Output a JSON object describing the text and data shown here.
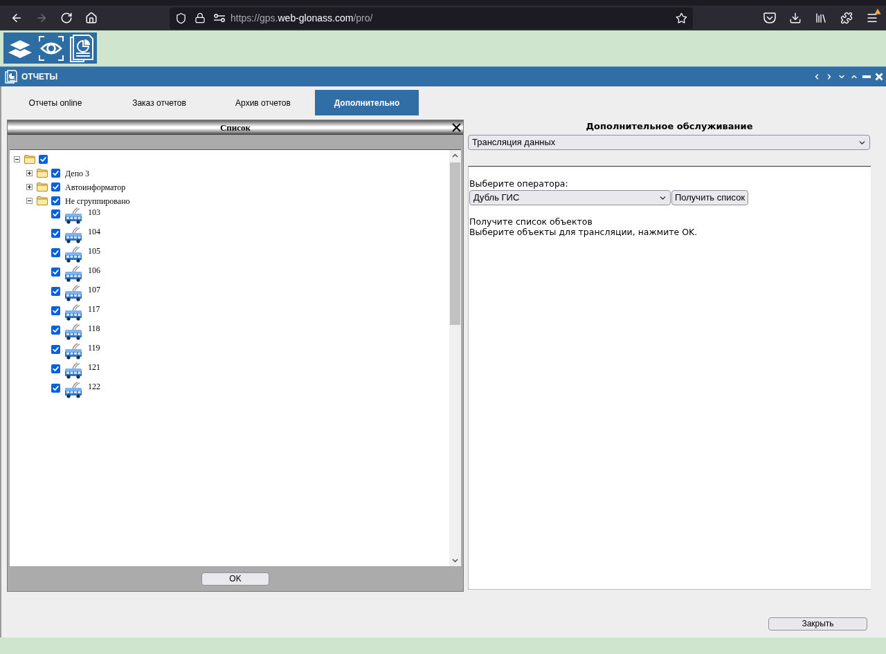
{
  "browser": {
    "nav_buttons": [
      {
        "disabled": false
      },
      {
        "disabled": true
      },
      {
        "disabled": false
      },
      {
        "disabled": false
      }
    ],
    "url": {
      "prefix": "https://gps.",
      "domain": "web-glonass.com",
      "path": "/pro/"
    },
    "menu_alert": true
  },
  "window": {
    "title": "ОТЧЕТЫ"
  },
  "tabs": [
    {
      "label": "Отчеты online",
      "selected": false
    },
    {
      "label": "Заказ отчетов",
      "selected": false
    },
    {
      "label": "Архив отчетов",
      "selected": false
    },
    {
      "label": "Дополнительно",
      "selected": true
    }
  ],
  "list_panel": {
    "title": "Список",
    "tree": {
      "kind": "folder",
      "checked": true,
      "expanded": true,
      "children": [
        {
          "kind": "folder",
          "label": "Депо 3",
          "checked": true,
          "expanded": false
        },
        {
          "kind": "folder",
          "label": "Автоинформатор",
          "checked": true,
          "expanded": false
        },
        {
          "kind": "folder",
          "label": "Не сгруппировано",
          "checked": true,
          "expanded": true,
          "children": [
            {
              "kind": "vehicle",
              "label": "103",
              "checked": true
            },
            {
              "kind": "vehicle",
              "label": "104",
              "checked": true
            },
            {
              "kind": "vehicle",
              "label": "105",
              "checked": true
            },
            {
              "kind": "vehicle",
              "label": "106",
              "checked": true
            },
            {
              "kind": "vehicle",
              "label": "107",
              "checked": true
            },
            {
              "kind": "vehicle",
              "label": "117",
              "checked": true
            },
            {
              "kind": "vehicle",
              "label": "118",
              "checked": true
            },
            {
              "kind": "vehicle",
              "label": "119",
              "checked": true
            },
            {
              "kind": "vehicle",
              "label": "121",
              "checked": true
            },
            {
              "kind": "vehicle",
              "label": "122",
              "checked": true
            }
          ]
        }
      ]
    },
    "ok_button": "OK"
  },
  "service_panel": {
    "title": "Дополнительное обслуживание",
    "service_select": {
      "value": "Трансляция данных"
    },
    "operator_label": "Выберите оператора:",
    "operator_select": {
      "value": "Дубль ГИС"
    },
    "get_list_button": "Получить список",
    "instructions": [
      "Получите список объектов",
      "Выберите объекты для трансляции, нажмите OK."
    ]
  },
  "close_button": "Закрыть"
}
